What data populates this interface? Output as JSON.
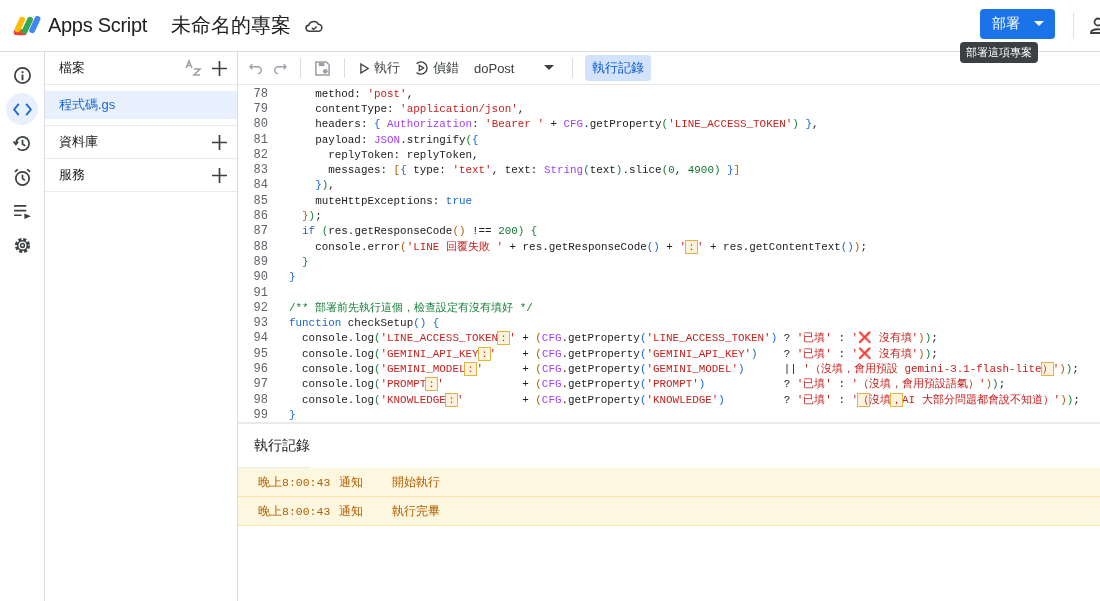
{
  "header": {
    "product": "Apps Script",
    "project_title": "未命名的專案",
    "deploy_button": "部署",
    "tooltip": "部署這項專案"
  },
  "rail": [
    {
      "kind": "info",
      "selected": false
    },
    {
      "kind": "code",
      "selected": true
    },
    {
      "kind": "history",
      "selected": false
    },
    {
      "kind": "alarm",
      "selected": false
    },
    {
      "kind": "executions",
      "selected": false
    },
    {
      "kind": "settings",
      "selected": false
    }
  ],
  "files_panel": {
    "title": "檔案",
    "files": [
      {
        "name": "程式碼.gs",
        "selected": true
      }
    ],
    "sections": [
      "資料庫",
      "服務"
    ]
  },
  "toolbar": {
    "run": "執行",
    "debug": "偵錯",
    "function": "doPost",
    "log_toggle": {
      "label": "執行記錄",
      "selected": true
    }
  },
  "code": [
    {
      "n": "78",
      "tokens": [
        {
          "kind": "plain",
          "text": "    method: "
        },
        {
          "kind": "string",
          "text": "'post'"
        },
        {
          "kind": "plain",
          "text": ","
        }
      ]
    },
    {
      "n": "79",
      "tokens": [
        {
          "kind": "plain",
          "text": "    contentType: "
        },
        {
          "kind": "string",
          "text": "'application/json'"
        },
        {
          "kind": "plain",
          "text": ","
        }
      ]
    },
    {
      "n": "80",
      "tokens": [
        {
          "kind": "plain",
          "text": "    headers: "
        },
        {
          "kind": "bracket1",
          "text": "{ "
        },
        {
          "kind": "global",
          "text": "Authorization"
        },
        {
          "kind": "plain",
          "text": ": "
        },
        {
          "kind": "string",
          "text": "'Bearer '"
        },
        {
          "kind": "plain",
          "text": " + "
        },
        {
          "kind": "global",
          "text": "CFG"
        },
        {
          "kind": "plain",
          "text": ".getProperty"
        },
        {
          "kind": "bracket2",
          "text": "("
        },
        {
          "kind": "string",
          "text": "'LINE_ACCESS_TOKEN'"
        },
        {
          "kind": "bracket2",
          "text": ") "
        },
        {
          "kind": "bracket1",
          "text": "}"
        },
        {
          "kind": "plain",
          "text": ","
        }
      ]
    },
    {
      "n": "81",
      "tokens": [
        {
          "kind": "plain",
          "text": "    payload: "
        },
        {
          "kind": "global",
          "text": "JSON"
        },
        {
          "kind": "plain",
          "text": ".stringify"
        },
        {
          "kind": "bracket2",
          "text": "("
        },
        {
          "kind": "bracket1",
          "text": "{"
        }
      ]
    },
    {
      "n": "82",
      "tokens": [
        {
          "kind": "plain",
          "text": "      replyToken: replyToken,"
        }
      ]
    },
    {
      "n": "83",
      "tokens": [
        {
          "kind": "plain",
          "text": "      messages: "
        },
        {
          "kind": "bracket3",
          "text": "["
        },
        {
          "kind": "bracket1",
          "text": "{"
        },
        {
          "kind": "plain",
          "text": " type: "
        },
        {
          "kind": "string",
          "text": "'text'"
        },
        {
          "kind": "plain",
          "text": ", text: "
        },
        {
          "kind": "global",
          "text": "String"
        },
        {
          "kind": "bracket2",
          "text": "("
        },
        {
          "kind": "plain",
          "text": "text"
        },
        {
          "kind": "bracket2",
          "text": ")"
        },
        {
          "kind": "plain",
          "text": ".slice"
        },
        {
          "kind": "bracket2",
          "text": "("
        },
        {
          "kind": "number",
          "text": "0"
        },
        {
          "kind": "plain",
          "text": ", "
        },
        {
          "kind": "number",
          "text": "4900"
        },
        {
          "kind": "bracket2",
          "text": ") "
        },
        {
          "kind": "bracket1",
          "text": "}"
        },
        {
          "kind": "bracket3",
          "text": "]"
        }
      ]
    },
    {
      "n": "84",
      "tokens": [
        {
          "kind": "bracket1",
          "text": "    }"
        },
        {
          "kind": "bracket2",
          "text": ")"
        },
        {
          "kind": "plain",
          "text": ","
        }
      ]
    },
    {
      "n": "85",
      "tokens": [
        {
          "kind": "plain",
          "text": "    muteHttpExceptions: "
        },
        {
          "kind": "keyword",
          "text": "true"
        }
      ]
    },
    {
      "n": "86",
      "tokens": [
        {
          "kind": "bracket3",
          "text": "  }"
        },
        {
          "kind": "bracket2",
          "text": ")"
        },
        {
          "kind": "plain",
          "text": ";"
        }
      ]
    },
    {
      "n": "87",
      "tokens": [
        {
          "kind": "keyword",
          "text": "  if "
        },
        {
          "kind": "bracket2",
          "text": "("
        },
        {
          "kind": "plain",
          "text": "res.getResponseCode"
        },
        {
          "kind": "bracket3",
          "text": "()"
        },
        {
          "kind": "plain",
          "text": " !== "
        },
        {
          "kind": "number",
          "text": "200"
        },
        {
          "kind": "bracket2",
          "text": ") {"
        }
      ]
    },
    {
      "n": "88",
      "tokens": [
        {
          "kind": "plain",
          "text": "    console.error"
        },
        {
          "kind": "bracket3",
          "text": "("
        },
        {
          "kind": "string",
          "text": "'LINE 回覆失敗 '"
        },
        {
          "kind": "plain",
          "text": " + res.getResponseCode"
        },
        {
          "kind": "bracket1",
          "text": "()"
        },
        {
          "kind": "plain",
          "text": " + "
        },
        {
          "kind": "string",
          "text": "'"
        },
        {
          "kind": "flag",
          "text": "："
        },
        {
          "kind": "string",
          "text": "'"
        },
        {
          "kind": "plain",
          "text": " + res.getContentText"
        },
        {
          "kind": "bracket1",
          "text": "()"
        },
        {
          "kind": "bracket3",
          "text": ")"
        },
        {
          "kind": "plain",
          "text": ";"
        }
      ]
    },
    {
      "n": "89",
      "tokens": [
        {
          "kind": "bracket2",
          "text": "  }"
        }
      ]
    },
    {
      "n": "90",
      "tokens": [
        {
          "kind": "bracket1",
          "text": "}"
        }
      ]
    },
    {
      "n": "91"
    },
    {
      "n": "92",
      "tokens": [
        {
          "kind": "comment",
          "text": "/** 部署前先執行這個，檢查設定有沒有填好 */"
        }
      ]
    },
    {
      "n": "93",
      "tokens": [
        {
          "kind": "keyword",
          "text": "function"
        },
        {
          "kind": "plain",
          "text": " checkSetup"
        },
        {
          "kind": "bracket1",
          "text": "() {"
        }
      ]
    },
    {
      "n": "94",
      "tokens": [
        {
          "kind": "plain",
          "text": "  console.log"
        },
        {
          "kind": "bracket2",
          "text": "("
        },
        {
          "kind": "string",
          "text": "'LINE_ACCESS_TOKEN"
        },
        {
          "kind": "flag",
          "text": "："
        },
        {
          "kind": "string",
          "text": "'"
        },
        {
          "kind": "plain",
          "text": " + "
        },
        {
          "kind": "bracket3",
          "text": "("
        },
        {
          "kind": "global",
          "text": "CFG"
        },
        {
          "kind": "plain",
          "text": ".getProperty"
        },
        {
          "kind": "bracket1",
          "text": "("
        },
        {
          "kind": "string",
          "text": "'LINE_ACCESS_TOKEN'"
        },
        {
          "kind": "bracket1",
          "text": ")"
        },
        {
          "kind": "plain",
          "text": " ? "
        },
        {
          "kind": "string",
          "text": "'已填'"
        },
        {
          "kind": "plain",
          "text": " : "
        },
        {
          "kind": "string",
          "text": "'❌ 沒有填'"
        },
        {
          "kind": "bracket3",
          "text": ")"
        },
        {
          "kind": "bracket2",
          "text": ")"
        },
        {
          "kind": "plain",
          "text": ";"
        }
      ]
    },
    {
      "n": "95",
      "tokens": [
        {
          "kind": "plain",
          "text": "  console.log"
        },
        {
          "kind": "bracket2",
          "text": "("
        },
        {
          "kind": "string",
          "text": "'GEMINI_API_KEY"
        },
        {
          "kind": "flag",
          "text": "："
        },
        {
          "kind": "string",
          "text": "'"
        },
        {
          "kind": "plain",
          "text": "    + "
        },
        {
          "kind": "bracket3",
          "text": "("
        },
        {
          "kind": "global",
          "text": "CFG"
        },
        {
          "kind": "plain",
          "text": ".getProperty"
        },
        {
          "kind": "bracket1",
          "text": "("
        },
        {
          "kind": "string",
          "text": "'GEMINI_API_KEY'"
        },
        {
          "kind": "bracket1",
          "text": ")"
        },
        {
          "kind": "plain",
          "text": "    ? "
        },
        {
          "kind": "string",
          "text": "'已填'"
        },
        {
          "kind": "plain",
          "text": " : "
        },
        {
          "kind": "string",
          "text": "'❌ 沒有填'"
        },
        {
          "kind": "bracket3",
          "text": ")"
        },
        {
          "kind": "bracket2",
          "text": ")"
        },
        {
          "kind": "plain",
          "text": ";"
        }
      ]
    },
    {
      "n": "96",
      "tokens": [
        {
          "kind": "plain",
          "text": "  console.log"
        },
        {
          "kind": "bracket2",
          "text": "("
        },
        {
          "kind": "string",
          "text": "'GEMINI_MODEL"
        },
        {
          "kind": "flag",
          "text": "："
        },
        {
          "kind": "string",
          "text": "'"
        },
        {
          "kind": "plain",
          "text": "      + "
        },
        {
          "kind": "bracket3",
          "text": "("
        },
        {
          "kind": "global",
          "text": "CFG"
        },
        {
          "kind": "plain",
          "text": ".getProperty"
        },
        {
          "kind": "bracket1",
          "text": "("
        },
        {
          "kind": "string",
          "text": "'GEMINI_MODEL'"
        },
        {
          "kind": "bracket1",
          "text": ")"
        },
        {
          "kind": "plain",
          "text": "      || "
        },
        {
          "kind": "string",
          "text": "'（沒填，會用預設 gemini-3.1-flash-lite"
        },
        {
          "kind": "flag",
          "text": "）"
        },
        {
          "kind": "string",
          "text": "'"
        },
        {
          "kind": "bracket3",
          "text": ")"
        },
        {
          "kind": "bracket2",
          "text": ")"
        },
        {
          "kind": "plain",
          "text": ";"
        }
      ]
    },
    {
      "n": "97",
      "tokens": [
        {
          "kind": "plain",
          "text": "  console.log"
        },
        {
          "kind": "bracket2",
          "text": "("
        },
        {
          "kind": "string",
          "text": "'PROMPT"
        },
        {
          "kind": "flag",
          "text": "："
        },
        {
          "kind": "string",
          "text": "'"
        },
        {
          "kind": "plain",
          "text": "            + "
        },
        {
          "kind": "bracket3",
          "text": "("
        },
        {
          "kind": "global",
          "text": "CFG"
        },
        {
          "kind": "plain",
          "text": ".getProperty"
        },
        {
          "kind": "bracket1",
          "text": "("
        },
        {
          "kind": "string",
          "text": "'PROMPT'"
        },
        {
          "kind": "bracket1",
          "text": ")"
        },
        {
          "kind": "plain",
          "text": "            ? "
        },
        {
          "kind": "string",
          "text": "'已填'"
        },
        {
          "kind": "plain",
          "text": " : "
        },
        {
          "kind": "string",
          "text": "'（沒填，會用預設語氣）'"
        },
        {
          "kind": "bracket3",
          "text": ")"
        },
        {
          "kind": "bracket2",
          "text": ")"
        },
        {
          "kind": "plain",
          "text": ";"
        }
      ]
    },
    {
      "n": "98",
      "tokens": [
        {
          "kind": "plain",
          "text": "  console.log"
        },
        {
          "kind": "bracket2",
          "text": "("
        },
        {
          "kind": "string",
          "text": "'KNOWLEDGE"
        },
        {
          "kind": "flag",
          "text": "："
        },
        {
          "kind": "string",
          "text": "'"
        },
        {
          "kind": "plain",
          "text": "         + "
        },
        {
          "kind": "bracket3",
          "text": "("
        },
        {
          "kind": "global",
          "text": "CFG"
        },
        {
          "kind": "plain",
          "text": ".getProperty"
        },
        {
          "kind": "bracket1",
          "text": "("
        },
        {
          "kind": "string",
          "text": "'KNOWLEDGE'"
        },
        {
          "kind": "bracket1",
          "text": ")"
        },
        {
          "kind": "plain",
          "text": "         ? "
        },
        {
          "kind": "string",
          "text": "'已填'"
        },
        {
          "kind": "plain",
          "text": " : "
        },
        {
          "kind": "string",
          "text": "'"
        },
        {
          "kind": "flag",
          "text": "（"
        },
        {
          "kind": "string",
          "text": "沒填"
        },
        {
          "kind": "flag",
          "text": "，"
        },
        {
          "kind": "string",
          "text": "AI 大部分問題都會說不知道）'"
        },
        {
          "kind": "bracket3",
          "text": ")"
        },
        {
          "kind": "bracket2",
          "text": ")"
        },
        {
          "kind": "plain",
          "text": ";"
        }
      ]
    },
    {
      "n": "99",
      "tokens": [
        {
          "kind": "bracket1",
          "text": "}"
        }
      ]
    }
  ],
  "log": {
    "title": "執行記錄",
    "entries": [
      {
        "time": "晚上8:00:43",
        "level": "通知",
        "message": "開始執行"
      },
      {
        "time": "晚上8:00:43",
        "level": "通知",
        "message": "執行完畢"
      }
    ]
  }
}
